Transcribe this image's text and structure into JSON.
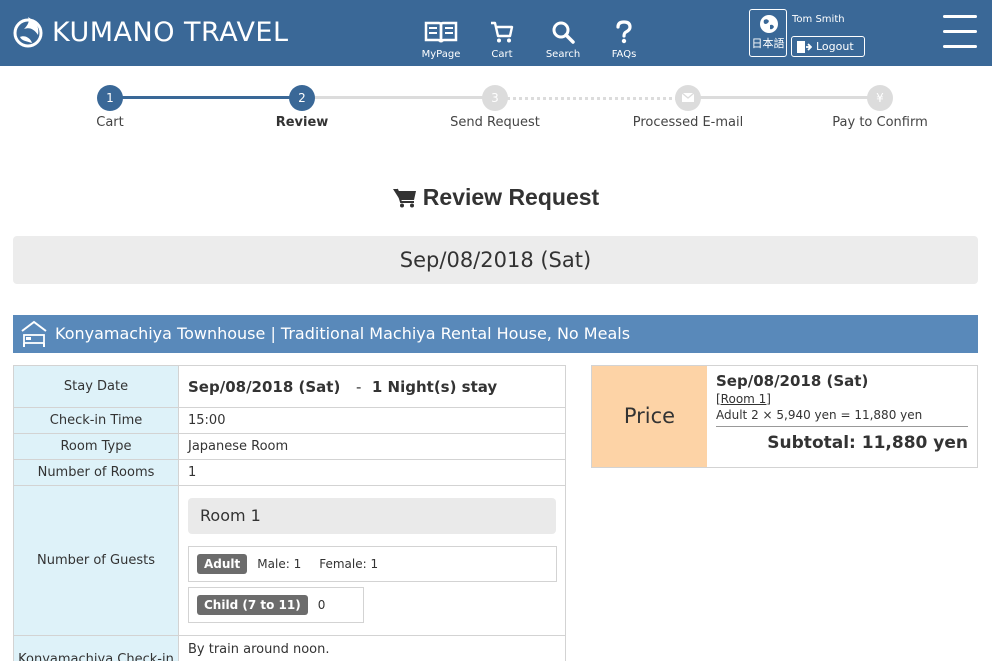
{
  "header": {
    "brand": "KUMANO TRAVEL",
    "nav": [
      {
        "label": "MyPage",
        "icon": "book-icon"
      },
      {
        "label": "Cart",
        "icon": "cart-icon"
      },
      {
        "label": "Search",
        "icon": "search-icon"
      },
      {
        "label": "FAQs",
        "icon": "question-icon"
      }
    ],
    "language_label": "日本語",
    "user_name": "Tom Smith",
    "logout_label": "Logout"
  },
  "steps": [
    {
      "number": "1",
      "label": "Cart",
      "state": "done"
    },
    {
      "number": "2",
      "label": "Review",
      "state": "active"
    },
    {
      "number": "3",
      "label": "Send Request",
      "state": "pending"
    },
    {
      "number": "",
      "label": "Processed E-mail",
      "state": "pending",
      "icon": "envelope-icon"
    },
    {
      "number": "¥",
      "label": "Pay to Confirm",
      "state": "pending"
    }
  ],
  "page_title": "Review Request",
  "date_heading": "Sep/08/2018 (Sat)",
  "accommodation": {
    "name": "Konyamachiya Townhouse | Traditional Machiya Rental House, No Meals"
  },
  "details": {
    "stay_date_label": "Stay Date",
    "stay_date": "Sep/08/2018 (Sat)",
    "stay_separator": "-",
    "nights": "1 Night(s) stay",
    "checkin_label": "Check-in Time",
    "checkin": "15:00",
    "room_type_label": "Room Type",
    "room_type": "Japanese Room",
    "rooms_label": "Number of Rooms",
    "rooms": "1",
    "guests_label": "Number of Guests",
    "room_title": "Room 1",
    "adult_badge": "Adult",
    "male": "Male: 1",
    "female": "Female: 1",
    "child_badge": "Child (7 to 11)",
    "child_count": "0",
    "konya_label": "Konyamachiya Check-in",
    "konya_value": "By train around noon."
  },
  "price": {
    "label": "Price",
    "date": "Sep/08/2018 (Sat)",
    "room": "[Room 1]",
    "line": "Adult  2 × 5,940 yen = 11,880 yen",
    "subtotal": "Subtotal: 11,880 yen"
  },
  "colors": {
    "header": "#3a6897",
    "step_active": "#3a6897",
    "step_pending": "#dcdcdc",
    "house_bar": "#5989ba",
    "label_cell": "#def2f9",
    "price_label": "#fdd3a6"
  }
}
